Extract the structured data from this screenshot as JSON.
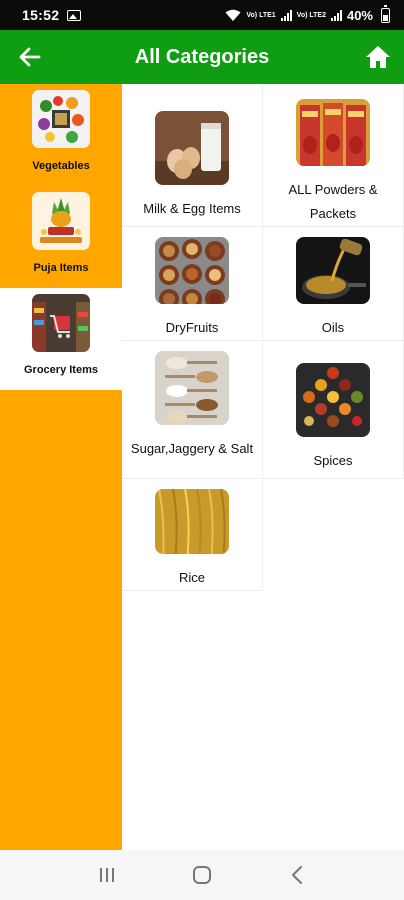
{
  "status_bar": {
    "time": "15:52",
    "network_labels": [
      "Vo) LTE1",
      "Vo) LTE2"
    ],
    "battery": "40%",
    "battery_level": 0.4,
    "icons": [
      "gallery-icon",
      "wifi-icon",
      "signal-icon",
      "battery-icon"
    ]
  },
  "app_bar": {
    "title": "All Categories",
    "background": "#0f9d12",
    "back_icon": "arrow-left-icon",
    "home_icon": "home-icon"
  },
  "sidebar": {
    "background": "#ffa600",
    "items": [
      {
        "label": "Vegetables",
        "selected": false
      },
      {
        "label": "Puja Items",
        "selected": false
      },
      {
        "label": "Grocery Items",
        "selected": true
      }
    ]
  },
  "categories": [
    {
      "label": "Milk & Egg Items"
    },
    {
      "label": "ALL Powders & Packets"
    },
    {
      "label": "DryFruits"
    },
    {
      "label": "Oils"
    },
    {
      "label": "Sugar,Jaggery & Salt"
    },
    {
      "label": "Spices"
    },
    {
      "label": "Rice"
    }
  ],
  "nav_bar": {
    "icons": [
      "recent-apps-icon",
      "home-button-icon",
      "back-button-icon"
    ]
  }
}
